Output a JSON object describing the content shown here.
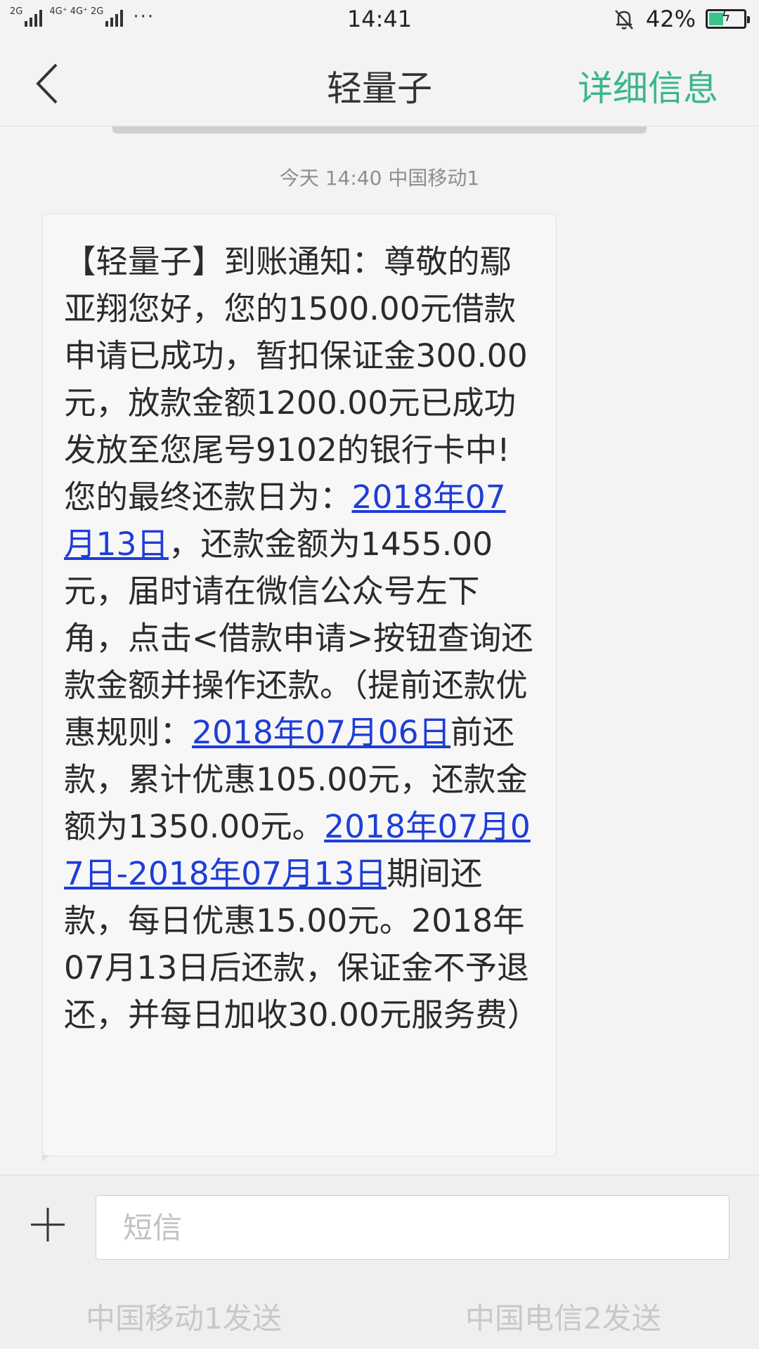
{
  "status_bar": {
    "sim1_label": "2G",
    "sim2_label": "4G⁺ 4G⁺ 2G",
    "more": "···",
    "time": "14:41",
    "battery_percent": "42%",
    "battery_level": 0.42,
    "battery_color": "#3bc48a"
  },
  "header": {
    "title": "轻量子",
    "detail_label": "详细信息",
    "accent_color": "#3bb58e"
  },
  "conversation": {
    "date_line": "今天  14:40  中国移动1",
    "message": {
      "seg1": "【轻量子】到账通知：尊敬的鄢亚翔您好，您的1500.00元借款申请已成功，暂扣保证金300.00元，放款金额1200.00元已成功发放至您尾号9102的银行卡中!您的最终还款日为：",
      "link1": "2018年07月13日",
      "seg2": "，还款金额为1455.00元，届时请在微信公众号左下角，点击<借款申请>按钮查询还款金额并操作还款。（提前还款优惠规则：",
      "link2": "2018年07月06日",
      "seg3": "前还款，累计优惠105.00元，还款金额为1350.00元。",
      "link3": "2018年07月07日-2018年07月13日",
      "seg4": "期间还款，每日优惠15.00元。2018年07月13日后还款，保证金不予退还，并每日加收30.00元服务费）",
      "link_color": "#1f3dd6"
    }
  },
  "compose": {
    "input_placeholder": "短信",
    "send_sim1": "中国移动1发送",
    "send_sim2": "中国电信2发送"
  }
}
